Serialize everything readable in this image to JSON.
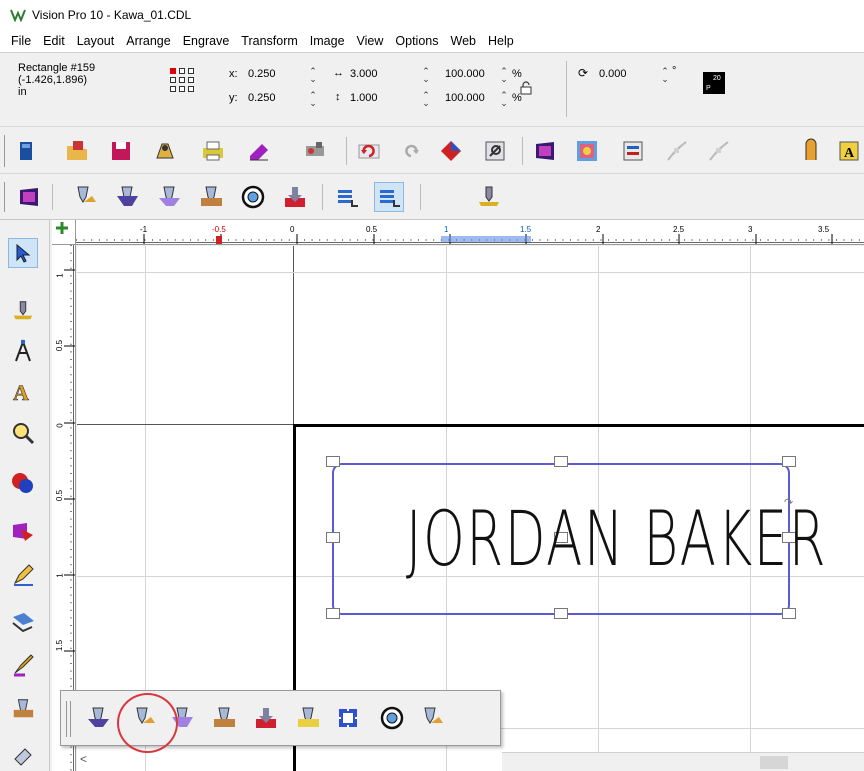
{
  "window": {
    "title": "Vision Pro 10 - Kawa_01.CDL"
  },
  "menu": [
    "File",
    "Edit",
    "Layout",
    "Arrange",
    "Engrave",
    "Transform",
    "Image",
    "View",
    "Options",
    "Web",
    "Help"
  ],
  "properties": {
    "object_name": "Rectangle #159",
    "coords": "(-1.426,1.896)",
    "units": "in",
    "x_label": "x:",
    "x_value": "0.250",
    "y_label": "y:",
    "y_value": "0.250",
    "width_value": "3.000",
    "height_value": "1.000",
    "scale_x_value": "100.000",
    "scale_y_value": "100.000",
    "percent_symbol": "%",
    "rotation_value": "0.000",
    "degree_symbol": "°",
    "swatch_label_top": "20",
    "swatch_label_bottom": "P",
    "swatch_color": "#000000"
  },
  "ruler": {
    "top_labels": [
      "-1",
      "-0.5",
      "0",
      "0.5",
      "1",
      "1.5",
      "2",
      "2.5",
      "3",
      "3.5"
    ],
    "left_labels": [
      "1",
      "0.5",
      "0",
      "0.5",
      "1",
      "1.5"
    ]
  },
  "canvas": {
    "engrave_text": "JORDAN BAKER",
    "selection_color": "#5b5bd6"
  },
  "toolbar1_icons": [
    "open-icon",
    "folder-open-icon",
    "save-icon",
    "toolpath-icon",
    "printer-icon",
    "eraser-icon",
    "machine-icon",
    "undo-icon",
    "redo-icon",
    "diamond-icon",
    "view-icon",
    "material-icon",
    "image-icon",
    "layers-icon",
    "node-icon",
    "node2-icon",
    "align-icon",
    "text-icon"
  ],
  "toolbar2_icons": [
    "material-view-icon",
    "cutter-a-icon",
    "cutter-b-icon",
    "cutter-c-icon",
    "cutter-d-icon",
    "target-icon",
    "download-icon",
    "layer-down-icon",
    "layer-add-icon",
    "engrave-icon"
  ],
  "left_tools": [
    "pointer-icon",
    "engrave-tool-icon",
    "node-edit-icon",
    "text-tool-icon",
    "zoom-icon",
    "shapes-icon",
    "fill-icon",
    "pen-icon",
    "transform-icon",
    "paint-icon",
    "toolpath-tool-icon",
    "eraser-tool-icon"
  ],
  "popup_icons": [
    "toolpath-flat-icon",
    "toolpath-bevel-icon",
    "toolpath-v-icon",
    "toolpath-pocket-icon",
    "toolpath-down-icon",
    "toolpath-edge-icon",
    "toolpath-fill-icon",
    "toolpath-target-icon",
    "toolpath-engrave-icon"
  ],
  "scroll": {
    "left_arrow": "<"
  }
}
